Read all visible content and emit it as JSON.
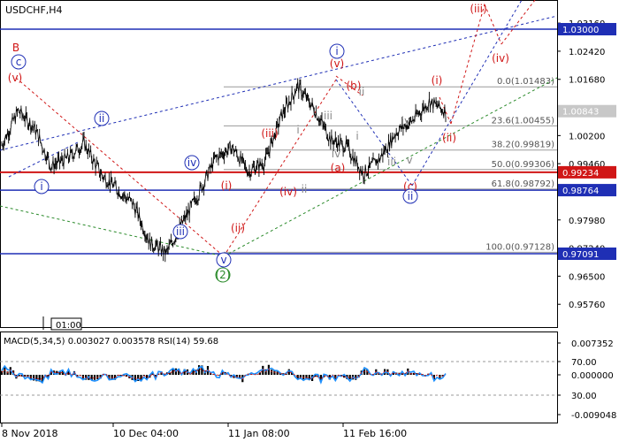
{
  "header": {
    "symbol_timeframe": "USDCHF,H4"
  },
  "price_axis": {
    "ticks": [
      "1.03160",
      "1.02420",
      "1.01680",
      "1.00843",
      "1.00200",
      "0.99460",
      "0.98720",
      "0.97980",
      "0.97240",
      "0.96500",
      "0.95760"
    ],
    "tick_values": [
      1.0316,
      1.0242,
      1.0168,
      1.00843,
      1.002,
      0.9946,
      0.9872,
      0.9798,
      0.9724,
      0.965,
      0.9576
    ]
  },
  "price_tags": [
    {
      "label": "1.03000",
      "value": 1.03,
      "color": "#1f2fb5",
      "text_color": "#ffffff"
    },
    {
      "label": "1.00843",
      "value": 1.00843,
      "color": "#c8c8c8",
      "text_color": "#ffffff"
    },
    {
      "label": "0.99234",
      "value": 0.99234,
      "color": "#d01616",
      "text_color": "#ffffff"
    },
    {
      "label": "0.98764",
      "value": 0.98764,
      "color": "#1f2fb5",
      "text_color": "#ffffff"
    },
    {
      "label": "0.97091",
      "value": 0.97091,
      "color": "#1f2fb5",
      "text_color": "#ffffff"
    }
  ],
  "fibonacci": [
    {
      "label": "0.0(1.01483)",
      "value": 1.01483
    },
    {
      "label": "23.6(1.00455)",
      "value": 1.00455
    },
    {
      "label": "38.2(0.99819)",
      "value": 0.99819
    },
    {
      "label": "50.0(0.99306)",
      "value": 0.99306
    },
    {
      "label": "61.8(0.98792)",
      "value": 0.98792
    },
    {
      "label": "100.0(0.97128)",
      "value": 0.97128
    }
  ],
  "time_axis": {
    "labels": [
      "8 Nov 2018",
      "10 Dec 04:00",
      "11 Jan 08:00",
      "11 Feb 16:00"
    ]
  },
  "time_marker": "01:00",
  "indicator": {
    "title": "MACD(5,34,5) 0.003027 0.003578 RSI(14) 59.68",
    "ticks": [
      "0.007352",
      "70.00",
      "0.000000",
      "30.00",
      "-0.009048"
    ]
  },
  "wave_labels": [
    {
      "text": "B",
      "color": "#d01616",
      "circled": false
    },
    {
      "text": "c",
      "color": "#1f2fb5",
      "circled": true
    },
    {
      "text": "(v)",
      "color": "#d01616",
      "circled": false
    },
    {
      "text": "ii",
      "color": "#1f2fb5",
      "circled": true
    },
    {
      "text": "i",
      "color": "#1f2fb5",
      "circled": true
    },
    {
      "text": "iv",
      "color": "#1f2fb5",
      "circled": true
    },
    {
      "text": "iii",
      "color": "#1f2fb5",
      "circled": true
    },
    {
      "text": "v",
      "color": "#1f2fb5",
      "circled": true
    },
    {
      "text": "(2)",
      "color": "#2a8a2a",
      "circled": true
    },
    {
      "text": "(i)",
      "color": "#d01616",
      "circled": false
    },
    {
      "text": "(ii)",
      "color": "#d01616",
      "circled": false
    },
    {
      "text": "(iii)",
      "color": "#d01616",
      "circled": false
    },
    {
      "text": "(iv)",
      "color": "#d01616",
      "circled": false
    },
    {
      "text": "ii",
      "color": "#888888",
      "circled": false
    },
    {
      "text": "i",
      "color": "#888888",
      "circled": false
    },
    {
      "text": "iii",
      "color": "#888888",
      "circled": false
    },
    {
      "text": "iv",
      "color": "#888888",
      "circled": false
    },
    {
      "text": "(a)",
      "color": "#d01616",
      "circled": false
    },
    {
      "text": "i",
      "color": "#1f2fb5",
      "circled": true
    },
    {
      "text": "(v)",
      "color": "#d01616",
      "circled": false
    },
    {
      "text": "(b)",
      "color": "#d01616",
      "circled": false
    },
    {
      "text": "ii",
      "color": "#888888",
      "circled": false
    },
    {
      "text": "i",
      "color": "#888888",
      "circled": false
    },
    {
      "text": "iv",
      "color": "#888888",
      "circled": false
    },
    {
      "text": "iii",
      "color": "#888888",
      "circled": false
    },
    {
      "text": "v",
      "color": "#888888",
      "circled": false
    },
    {
      "text": "(c)",
      "color": "#d01616",
      "circled": false
    },
    {
      "text": "ii",
      "color": "#1f2fb5",
      "circled": true
    },
    {
      "text": "(i)",
      "color": "#d01616",
      "circled": false
    },
    {
      "text": "(ii)",
      "color": "#d01616",
      "circled": false
    },
    {
      "text": "(iii)",
      "color": "#d01616",
      "circled": false
    },
    {
      "text": "(iv)",
      "color": "#d01616",
      "circled": false
    }
  ],
  "chart_data": {
    "type": "line",
    "title": "USDCHF,H4",
    "ylim": [
      0.956,
      1.034
    ],
    "x": [
      "8 Nov 2018",
      "10 Dec 04:00",
      "11 Jan 08:00",
      "11 Feb 16:00"
    ],
    "series": [
      {
        "values": [
          0.9995,
          1.0085,
          1.004,
          0.994,
          0.996,
          1.0,
          0.992,
          0.988,
          0.984,
          0.974,
          0.971,
          0.979,
          0.987,
          0.996,
          0.999,
          0.9925,
          0.995,
          1.007,
          1.015,
          1.009,
          1.001,
          0.999,
          0.992,
          0.996,
          1.003,
          1.006,
          1.011,
          1.0084
        ]
      }
    ],
    "macd_ylim": [
      -0.009048,
      0.007352
    ]
  }
}
